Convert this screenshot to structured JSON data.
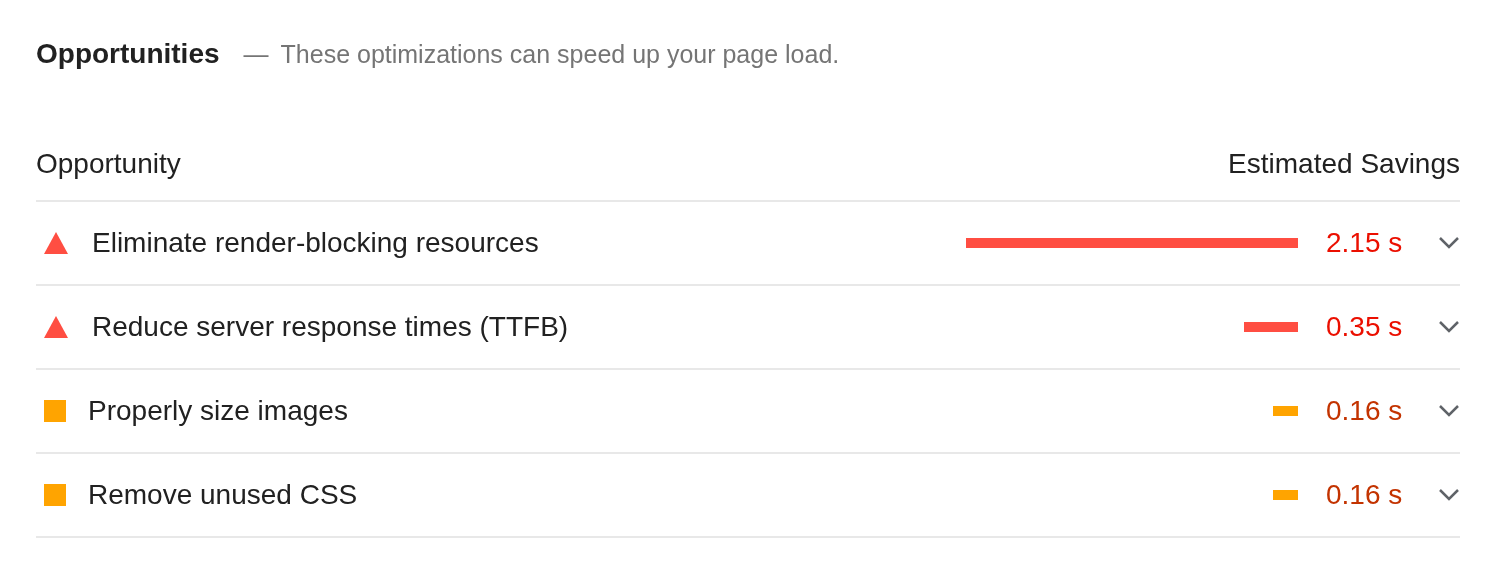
{
  "section": {
    "title": "Opportunities",
    "separator": "—",
    "description": "These optimizations can speed up your page load."
  },
  "columns": [
    "Opportunity",
    "Estimated Savings"
  ],
  "rows": [
    {
      "kind": "fail",
      "title": "Eliminate render-blocking resources",
      "savings": "2.15 s",
      "expanded": false
    },
    {
      "kind": "fail",
      "title": "Reduce server response times (TTFB)",
      "savings": "0.35 s",
      "expanded": false
    },
    {
      "kind": "average",
      "title": "Properly size images",
      "savings": "0.16 s",
      "expanded": false
    },
    {
      "kind": "average",
      "title": "Remove unused CSS",
      "savings": "0.16 s",
      "expanded": false
    }
  ]
}
